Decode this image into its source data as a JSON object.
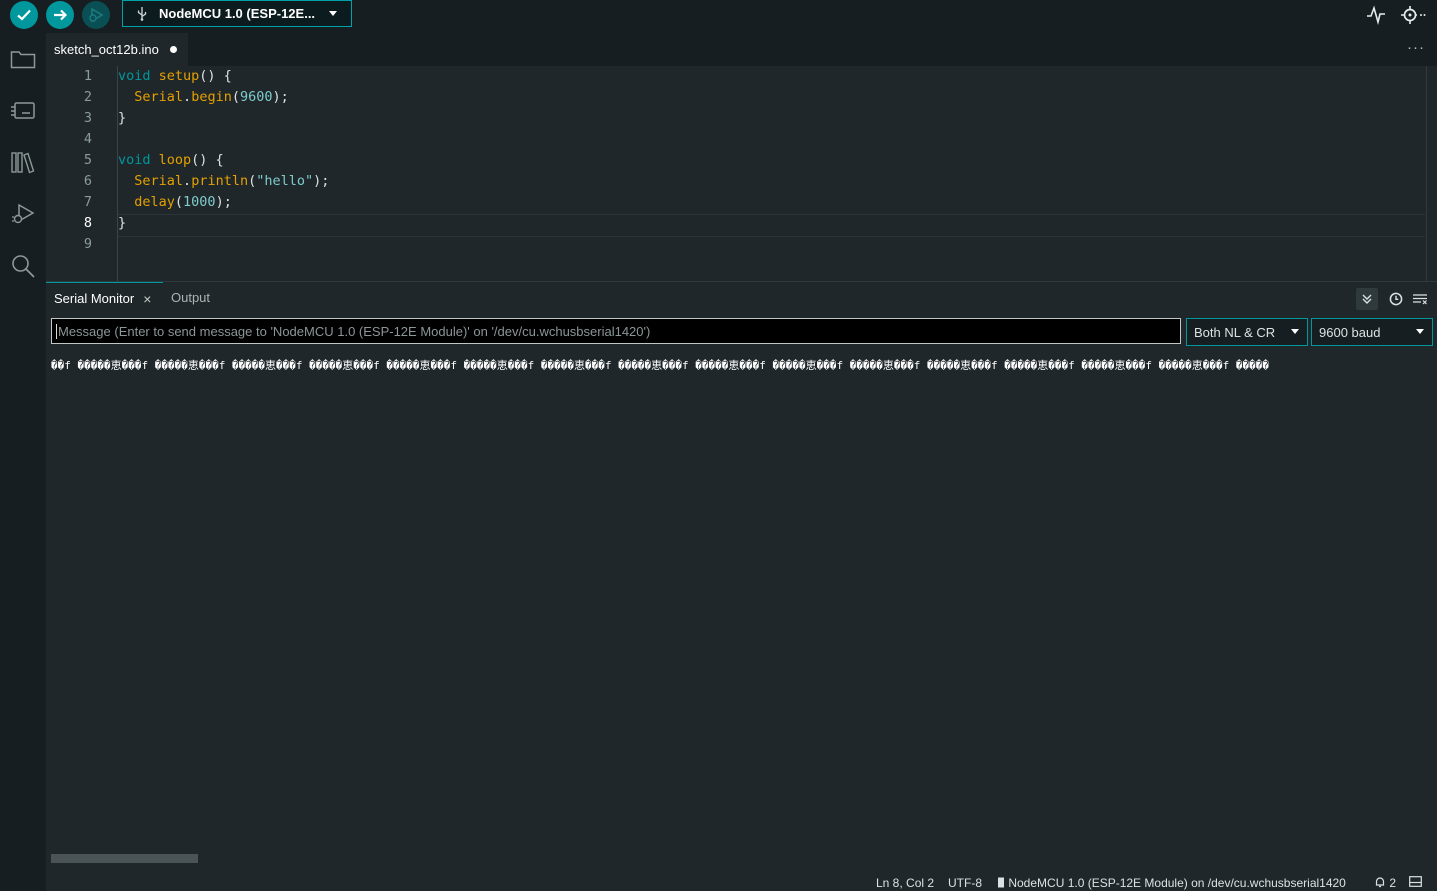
{
  "toolbar": {
    "board_label": "NodeMCU 1.0 (ESP-12E...",
    "icons": [
      "verify-icon",
      "upload-icon",
      "debug-icon",
      "usb-icon",
      "serial-plotter-icon",
      "serial-monitor-icon"
    ]
  },
  "sidebar": {
    "items": [
      "folder-icon",
      "boards-manager-icon",
      "library-manager-icon",
      "debug-run-icon",
      "search-icon"
    ]
  },
  "editor": {
    "tab_name": "sketch_oct12b.ino",
    "more": "···",
    "line_numbers": [
      "1",
      "2",
      "3",
      "4",
      "5",
      "6",
      "7",
      "8",
      "9"
    ],
    "code": {
      "l1": {
        "kw": "void",
        "fn": "setup",
        "rest": "() {"
      },
      "l2": {
        "obj": "Serial",
        "dot": ".",
        "fn": "begin",
        "open": "(",
        "num": "9600",
        "close": ");"
      },
      "l3": "}",
      "l5": {
        "kw": "void",
        "fn": "loop",
        "rest": "() {"
      },
      "l6": {
        "obj": "Serial",
        "dot": ".",
        "fn": "println",
        "open": "(",
        "str": "\"hello\"",
        "close": ");"
      },
      "l7": {
        "fn": "delay",
        "open": "(",
        "num": "1000",
        "close": ");"
      },
      "l8": "}"
    }
  },
  "panel": {
    "tab_serial": "Serial Monitor",
    "tab_close": "×",
    "tab_output": "Output",
    "message_placeholder": "Message (Enter to send message to 'NodeMCU 1.0 (ESP-12E Module)' on '/dev/cu.wchusbserial1420')",
    "line_ending": "Both NL & CR",
    "baud": "9600 baud",
    "output_text": "��f �����恵���f �����恵���f �����恵���f �����恵���f �����恵���f �����恵���f �����恵���f �����恵���f �����恵���f �����恵���f �����恵���f �����恵���f �����恵���f �����恵���f �����恵���f �����"
  },
  "status": {
    "position": "Ln 8, Col 2",
    "encoding": "UTF-8",
    "board": "NodeMCU 1.0 (ESP-12E Module) on /dev/cu.wchusbserial1420",
    "notifications": "2"
  }
}
